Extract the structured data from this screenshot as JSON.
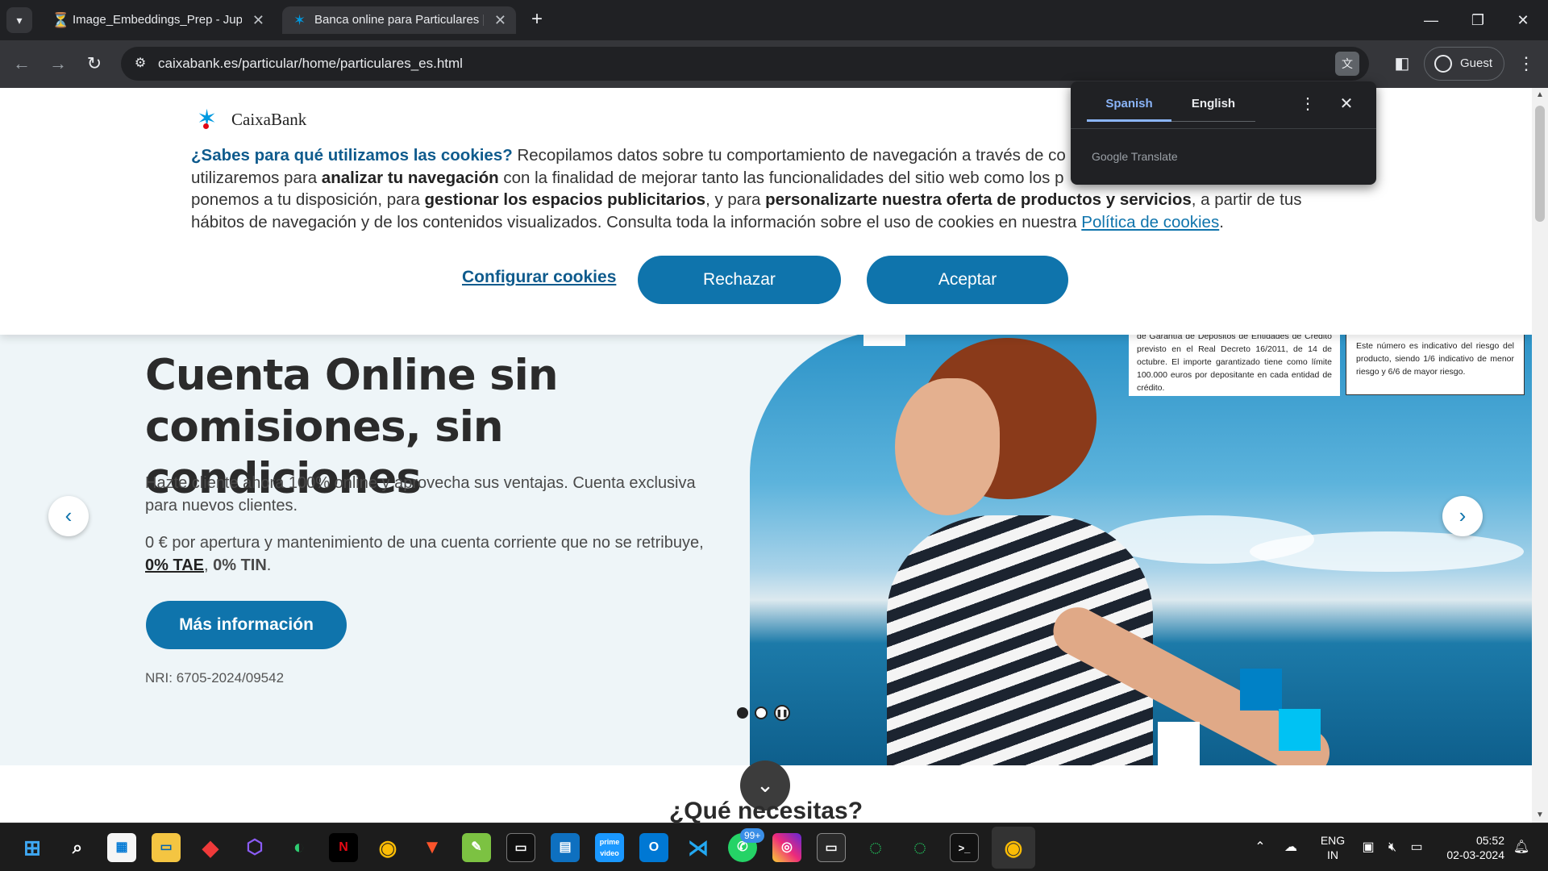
{
  "browser": {
    "tabs": [
      {
        "title": "Image_Embeddings_Prep - Jupy",
        "favicon": "⏳",
        "active": false
      },
      {
        "title": "Banca online para Particulares |",
        "favicon": "✶",
        "active": true
      }
    ],
    "url": "caixabank.es/particular/home/particulares_es.html",
    "guest_label": "Guest"
  },
  "translate_popup": {
    "languages": [
      "Spanish",
      "English"
    ],
    "selected": "Spanish",
    "brand": "Google Translate"
  },
  "cookie_banner": {
    "logo_text": "CaixaBank",
    "question": "¿Sabes para qué utilizamos las cookies?",
    "text_1": " Recopilamos datos sobre tu comportamiento de navegación a través de co",
    "text_2": "utilizaremos para ",
    "bold_1": "analizar tu navegación",
    "text_3": " con la finalidad de mejorar tanto las funcionalidades del sitio web como los p",
    "text_4": "ponemos a tu disposición, para ",
    "bold_2": "gestionar los espacios publicitarios",
    "text_5": ", y para ",
    "bold_3": "personalizarte nuestra oferta de productos y servicios",
    "text_6": ", a partir de tus hábitos de navegación y de los contenidos visualizados. Consulta toda la información sobre el uso de cookies en nuestra ",
    "policy_link": "Política de cookies",
    "text_end": ".",
    "configure_label": "Configurar cookies",
    "reject_label": "Rechazar",
    "accept_label": "Aceptar"
  },
  "hero": {
    "title": "Cuenta Online sin comisiones, sin condiciones",
    "description": "Hazte cliente ahora 100% online y aprovecha sus ventajas. Cuenta exclusiva para nuevos clientes.",
    "fees_text": "0 € por apertura y mantenimiento de una cuenta corriente que no se retribuye, ",
    "tae": "0% TAE",
    "separator": ", ",
    "tin": "0% TIN",
    "fees_end": ".",
    "cta_label": "Más información",
    "nri": "NRI: 6705-2024/09542",
    "legal_deposit": "de Garantía de Depósitos de Entidades de Crédito previsto en el Real Decreto 16/2011, de 14 de octubre. El importe garantizado tiene como límite 100.000 euros por depositante en cada entidad de crédito.",
    "legal_risk": "Este número es indicativo del riesgo del producto, siendo 1/6 indicativo de menor riesgo y 6/6 de mayor riesgo.",
    "carousel_active_slide": 1,
    "carousel_slide_count": 2
  },
  "next_section": {
    "title": "¿Qué necesitas?"
  },
  "taskbar": {
    "apps": [
      "windows-start",
      "search",
      "store",
      "file-explorer",
      "anydesk",
      "copilot",
      "edge",
      "netflix",
      "chrome",
      "brave",
      "notepad",
      "terminal-dark",
      "azure-data-studio",
      "prime-video",
      "outlook",
      "vscode",
      "whatsapp",
      "instagram",
      "app-window",
      "ring-app-1",
      "ring-app-2",
      "terminal",
      "chrome-active"
    ],
    "whatsapp_badge": "99+",
    "language_1": "ENG",
    "language_2": "IN",
    "time": "05:52",
    "date": "02-03-2024"
  },
  "colors": {
    "brand_blue": "#0f74ac",
    "dark_navy": "#0f5b8d",
    "chrome_bg": "#202124",
    "taskbar_bg": "#1c1c1c"
  }
}
